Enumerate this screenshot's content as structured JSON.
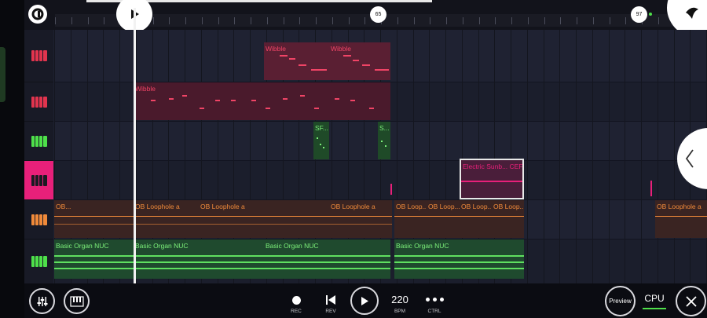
{
  "markers": {
    "m65": "65",
    "m97": "97"
  },
  "tracks": [
    {
      "id": "t1",
      "icon_color": "#e1344e"
    },
    {
      "id": "t2",
      "icon_color": "#e1344e"
    },
    {
      "id": "t3",
      "icon_color": "#4ee04a"
    },
    {
      "id": "t4",
      "icon_color": "#1a1a22",
      "selected": true
    },
    {
      "id": "t5",
      "icon_color": "#f08a3a"
    },
    {
      "id": "t6",
      "icon_color": "#4ee04a"
    }
  ],
  "clips": {
    "wibble1": "Wibble",
    "wibble2": "Wibble",
    "wibble3": "Wibble",
    "sf1": "SF...",
    "sf2": "S...",
    "electric": "Electric Sunb... CEF",
    "ob1": "OB...",
    "ob2": "OB Loophole a",
    "ob3": "OB Loophole a",
    "ob4": "OB Loophole a",
    "ob5": "OB Loop...",
    "ob6": "OB Loop...",
    "ob7": "OB Loop...",
    "ob8": "OB Loop...",
    "ob9": "OB Loophole a",
    "organ1": "Basic Organ NUC",
    "organ2": "Basic Organ NUC",
    "organ3": "Basic Organ NUC",
    "organ4": "Basic Organ NUC"
  },
  "transport": {
    "rec": "REC",
    "rev": "REV",
    "bpm_value": "220",
    "bpm": "BPM",
    "ctrl": "CTRL",
    "preview": "Preview",
    "cpu": "CPU"
  },
  "colors": {
    "red": "#e1344e",
    "green": "#4ee04a",
    "orange": "#f08a3a",
    "pink": "#e8207a"
  }
}
